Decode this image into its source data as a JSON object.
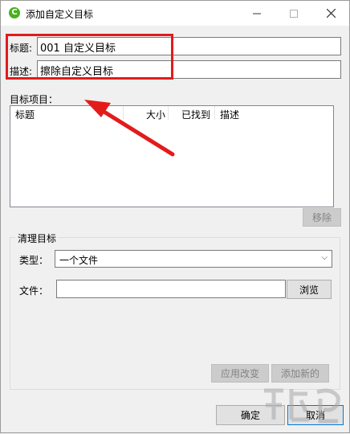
{
  "window": {
    "title": "添加自定义目标",
    "app_icon": "app-logo-icon",
    "minimize_icon": "minimize-icon",
    "maximize_icon": "maximize-icon",
    "close_icon": "close-icon"
  },
  "form": {
    "title_label": "标题:",
    "title_value": "001 自定义目标",
    "desc_label": "描述:",
    "desc_value": "擦除自定义目标"
  },
  "targets": {
    "section_label": "目标项目：",
    "columns": [
      "标题",
      "大小",
      "已找到",
      "描述"
    ],
    "rows": [],
    "remove_button": "移除"
  },
  "clean_target": {
    "group_label": "清理目标",
    "type_label": "类型：",
    "type_selected": "一个文件",
    "file_label": "文件：",
    "file_value": "",
    "browse_button": "浏览",
    "apply_button": "应用改变",
    "add_button": "添加新的"
  },
  "footer": {
    "ok_button": "确定",
    "cancel_button": "取消"
  },
  "annotation": {
    "highlight_color": "#e31b1b",
    "arrow_color": "#e31b1b"
  }
}
